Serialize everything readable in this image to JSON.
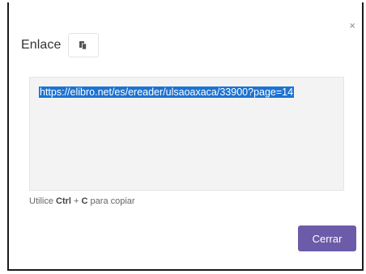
{
  "dialog": {
    "title": "Enlace",
    "close_glyph": "×",
    "copy_icon": "copy-icon",
    "link_text": "https://elibro.net/es/ereader/ulsaoaxaca/33900?page=14",
    "hint": {
      "prefix": "Utilice",
      "key1": "Ctrl",
      "plus": "+",
      "key2": "C",
      "suffix": "para copiar"
    },
    "close_button_label": "Cerrar"
  },
  "colors": {
    "selection": "#1b73d3",
    "primary_button": "#6b5ba8",
    "textarea_bg": "#f3f3f3"
  }
}
